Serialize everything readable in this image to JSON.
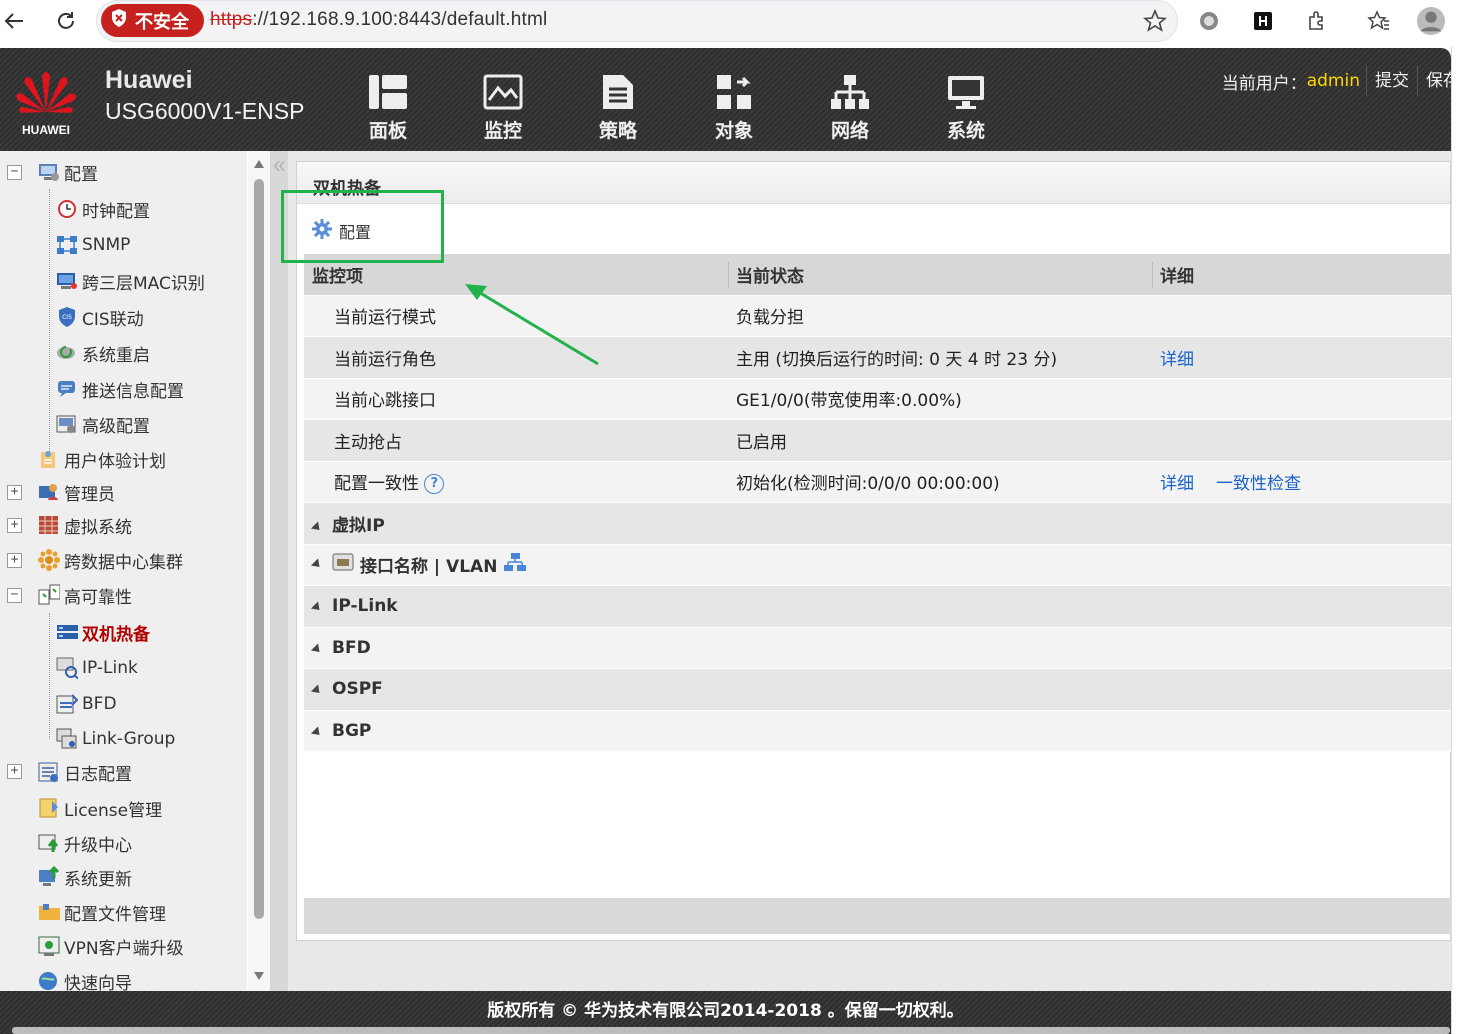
{
  "browser": {
    "security_label": "不安全",
    "url_scheme": "https",
    "url_rest": "://192.168.9.100:8443/default.html"
  },
  "header": {
    "logo_text": "HUAWEI",
    "brand": "Huawei",
    "model": "USG6000V1-ENSP",
    "nav": [
      {
        "label": "面板",
        "icon": "dashboard-icon"
      },
      {
        "label": "监控",
        "icon": "monitor-chart-icon"
      },
      {
        "label": "策略",
        "icon": "policy-doc-icon"
      },
      {
        "label": "对象",
        "icon": "object-icon"
      },
      {
        "label": "网络",
        "icon": "network-icon"
      },
      {
        "label": "系统",
        "icon": "system-screen-icon"
      }
    ],
    "user_prefix": "当前用户：",
    "user_name": "admin",
    "submit_label": "提交",
    "save_label": "保存"
  },
  "sidebar": {
    "items": [
      {
        "label": "配置",
        "icon": "config-monitor-icon"
      },
      {
        "label": "时钟配置",
        "icon": "clock-icon"
      },
      {
        "label": "SNMP",
        "icon": "snmp-icon"
      },
      {
        "label": "跨三层MAC识别",
        "icon": "mac-id-icon"
      },
      {
        "label": "CIS联动",
        "icon": "cis-shield-icon"
      },
      {
        "label": "系统重启",
        "icon": "restart-icon"
      },
      {
        "label": "推送信息配置",
        "icon": "push-message-icon"
      },
      {
        "label": "高级配置",
        "icon": "advanced-config-icon"
      },
      {
        "label": "用户体验计划",
        "icon": "user-experience-icon"
      },
      {
        "label": "管理员",
        "icon": "admin-icon"
      },
      {
        "label": "虚拟系统",
        "icon": "virtual-system-icon"
      },
      {
        "label": "跨数据中心集群",
        "icon": "cluster-icon"
      },
      {
        "label": "高可靠性",
        "icon": "high-availability-icon"
      },
      {
        "label": "双机热备",
        "icon": "hot-standby-icon"
      },
      {
        "label": "IP-Link",
        "icon": "ip-link-icon"
      },
      {
        "label": "BFD",
        "icon": "bfd-icon"
      },
      {
        "label": "Link-Group",
        "icon": "link-group-icon"
      },
      {
        "label": "日志配置",
        "icon": "log-config-icon"
      },
      {
        "label": "License管理",
        "icon": "license-icon"
      },
      {
        "label": "升级中心",
        "icon": "upgrade-center-icon"
      },
      {
        "label": "系统更新",
        "icon": "system-update-icon"
      },
      {
        "label": "配置文件管理",
        "icon": "config-file-folder-icon"
      },
      {
        "label": "VPN客户端升级",
        "icon": "vpn-client-icon"
      },
      {
        "label": "快速向导",
        "icon": "quick-wizard-icon"
      }
    ]
  },
  "main": {
    "title": "双机热备",
    "config_link": "配置",
    "columns": [
      "监控项",
      "当前状态",
      "详细"
    ],
    "rows": [
      {
        "item": "当前运行模式",
        "status": "负载分担",
        "detail": "",
        "extra": ""
      },
      {
        "item": "当前运行角色",
        "status": "主用 (切换后运行的时间: 0 天 4 时 23 分)",
        "detail": "详细",
        "extra": ""
      },
      {
        "item": "当前心跳接口",
        "status": "GE1/0/0(带宽使用率:0.00%)",
        "detail": "",
        "extra": ""
      },
      {
        "item": "主动抢占",
        "status": "已启用",
        "detail": "",
        "extra": ""
      },
      {
        "item": "配置一致性",
        "status": "初始化(检测时间:0/0/0 00:00:00)",
        "detail": "详细",
        "extra": "一致性检查"
      }
    ],
    "help_symbol": "?",
    "sections": [
      "虚拟IP",
      "接口名称 | VLAN",
      "IP-Link",
      "BFD",
      "OSPF",
      "BGP"
    ]
  },
  "footer": {
    "copyright": "版权所有 © 华为技术有限公司2014-2018 。保留一切权利。"
  },
  "colors": {
    "accent_link": "#1a63c9",
    "active_item": "#b00000",
    "annotation_green": "#22b24c",
    "username": "#ffd700",
    "insecure_red": "#c5221f"
  }
}
